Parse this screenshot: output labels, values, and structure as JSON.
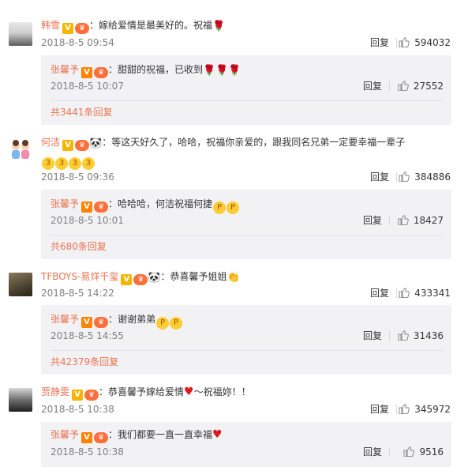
{
  "comments": [
    {
      "name": "韩雪",
      "text": "：嫁给爱情是最美好的。祝福",
      "time": "2018-8-5 09:54",
      "reply_label": "回复",
      "likes": "594032",
      "sub": {
        "name": "张馨予",
        "text": "：甜甜的祝福，已收到",
        "time": "2018-8-5 10:07",
        "reply_label": "回复",
        "likes": "27552",
        "more": "共3441条回复"
      }
    },
    {
      "name": "何洁",
      "text": "：等这天好久了，哈哈，祝福你亲爱的，跟我同名兄弟一定要幸福一辈子",
      "time": "2018-8-5 09:36",
      "reply_label": "回复",
      "likes": "384886",
      "sub": {
        "name": "张馨予",
        "text": "：哈哈哈，何洁祝福何捷",
        "time": "2018-8-5 10:01",
        "reply_label": "回复",
        "likes": "18427",
        "more": "共680条回复"
      }
    },
    {
      "name": "TFBOYS-易烊千玺",
      "text": "：恭喜馨予姐姐",
      "time": "2018-8-5 14:22",
      "reply_label": "回复",
      "likes": "433341",
      "sub": {
        "name": "张馨予",
        "text": "：谢谢弟弟",
        "time": "2018-8-5 14:55",
        "reply_label": "回复",
        "likes": "31436",
        "more": "共42379条回复"
      }
    },
    {
      "name": "贾静雯",
      "text": "：恭喜馨予嫁给爱情",
      "text2": "～祝福妳！！",
      "time": "2018-8-5 10:38",
      "reply_label": "回复",
      "likes": "345972",
      "sub": {
        "name": "张馨予",
        "text": "：我们都要一直一直幸福",
        "time": "2018-8-5 10:38",
        "reply_label": "回复",
        "likes": "9516"
      }
    }
  ],
  "colors": {
    "name": "#eb7350",
    "sub_bg": "#f2f2f5",
    "meta": "#808080"
  }
}
